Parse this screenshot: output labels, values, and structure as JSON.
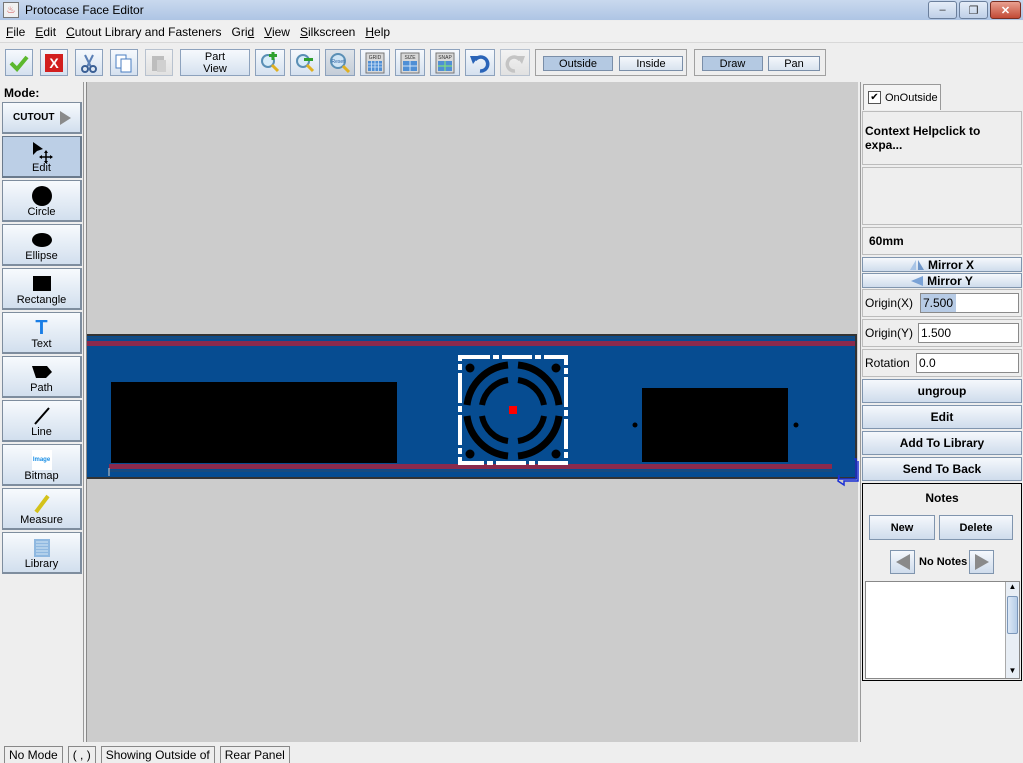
{
  "window": {
    "title": "Protocase Face Editor",
    "controls": {
      "minimize": "–",
      "restore": "❐",
      "close": "✕"
    }
  },
  "menubar": {
    "items": [
      {
        "mnemonic": "F",
        "rest": "ile"
      },
      {
        "mnemonic": "E",
        "rest": "dit"
      },
      {
        "mnemonic": "C",
        "rest": "utout Library and Fasteners"
      },
      {
        "pre": "Gri",
        "mnemonic": "d",
        "rest": ""
      },
      {
        "mnemonic": "V",
        "rest": "iew"
      },
      {
        "mnemonic": "S",
        "rest": "ilkscreen"
      },
      {
        "mnemonic": "H",
        "rest": "elp"
      }
    ]
  },
  "toolbar": {
    "icons": [
      "accept-check",
      "cancel-x",
      "cut-scissors",
      "copy",
      "paste",
      "zoom-in",
      "zoom-out",
      "zoom-reset",
      "grid",
      "size",
      "snap",
      "undo",
      "redo"
    ],
    "part_view_line1": "Part",
    "part_view_line2": "View",
    "grid_label": "GRID",
    "size_label": "SIZE",
    "snap_label": "SNAP",
    "reset_label": "Reset",
    "outside_label": "Outside",
    "inside_label": "Inside",
    "draw_label": "Draw",
    "pan_label": "Pan",
    "outside_active": true,
    "draw_active": true
  },
  "leftpanel": {
    "mode_label": "Mode:",
    "cutout_label": "CUTOUT",
    "tools": [
      {
        "label": "Edit",
        "icon": "edit-move-icon",
        "active": true
      },
      {
        "label": "Circle",
        "icon": "circle-icon"
      },
      {
        "label": "Ellipse",
        "icon": "ellipse-icon"
      },
      {
        "label": "Rectangle",
        "icon": "rectangle-icon"
      },
      {
        "label": "Text",
        "icon": "text-icon"
      },
      {
        "label": "Path",
        "icon": "path-icon"
      },
      {
        "label": "Line",
        "icon": "line-icon"
      },
      {
        "label": "Bitmap",
        "icon": "bitmap-icon"
      },
      {
        "label": "Measure",
        "icon": "measure-icon"
      },
      {
        "label": "Library",
        "icon": "library-icon"
      }
    ],
    "bitmap_icon_text": "Image"
  },
  "canvas": {
    "panel_color": "#064c91",
    "stripe_color": "#8a2a4d",
    "cutout_color": "#000000",
    "selection_marker_color": "#ff0000"
  },
  "rightpanel": {
    "tab_label": "OnOutside",
    "tab_checked": true,
    "context_help": "Context Helpclick to expa...",
    "dimension": "60mm",
    "mirror_x": "Mirror X",
    "mirror_y": "Mirror Y",
    "origin_x_label": "Origin(X)",
    "origin_x_value": "7.500",
    "origin_y_label": "Origin(Y)",
    "origin_y_value": "1.500",
    "rotation_label": "Rotation",
    "rotation_value": "0.0",
    "buttons": [
      "ungroup",
      "Edit",
      "Add To Library",
      "Send To Back"
    ],
    "notes": {
      "title": "Notes",
      "new_label": "New",
      "delete_label": "Delete",
      "status": "No Notes",
      "text": ""
    }
  },
  "statusbar": {
    "mode": "No Mode",
    "coords": "( , )",
    "showing": "Showing Outside of",
    "panel": "Rear Panel"
  }
}
